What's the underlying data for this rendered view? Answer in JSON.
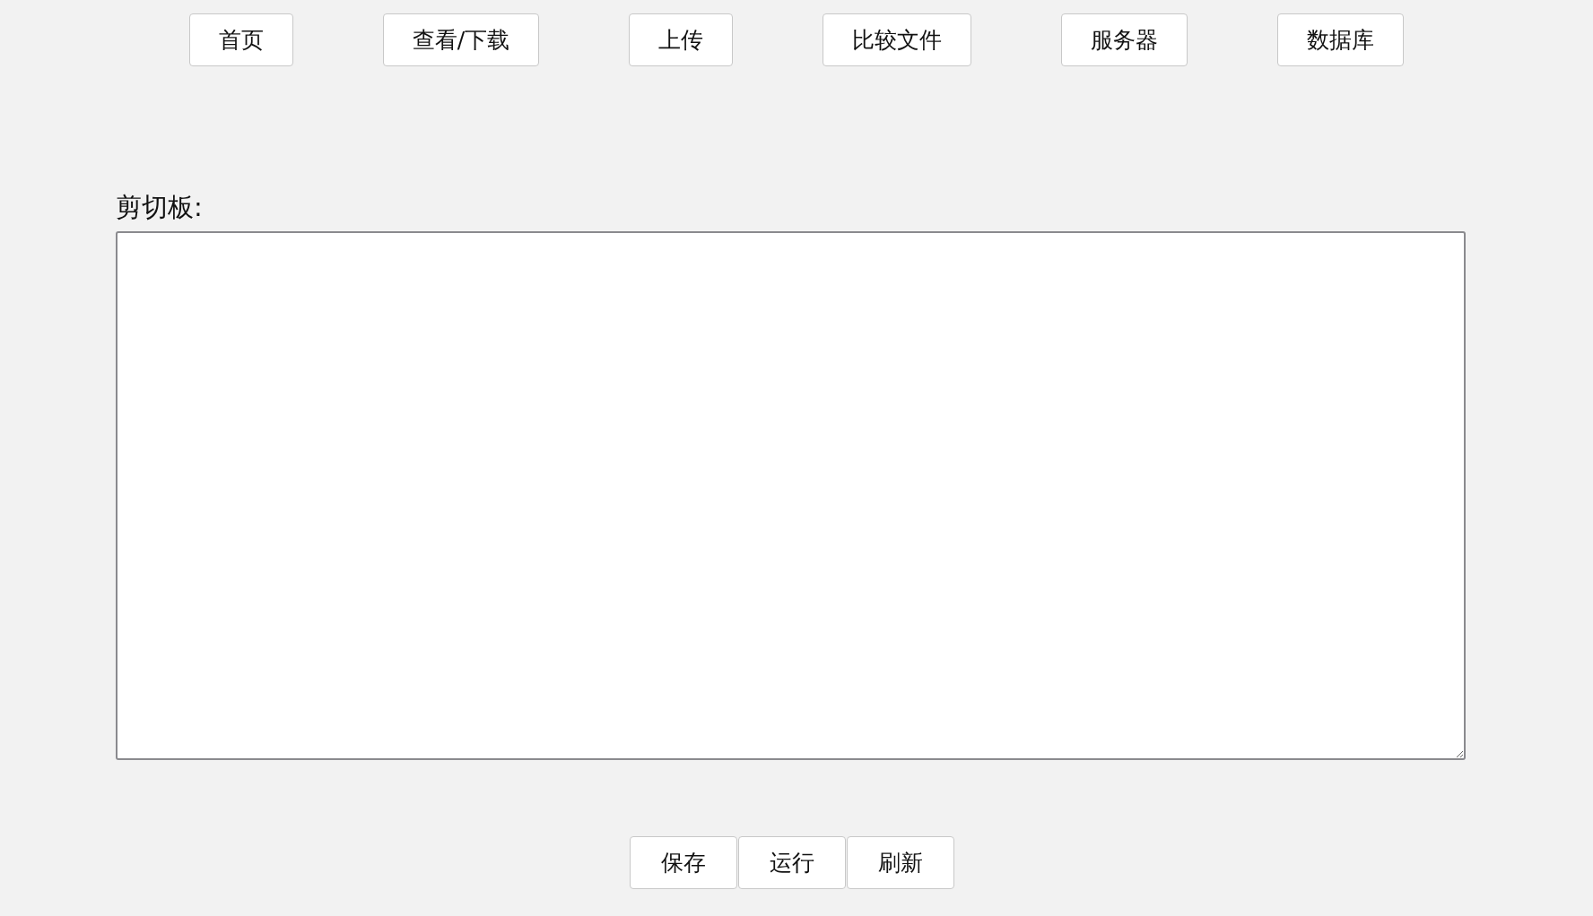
{
  "nav": [
    {
      "label": "首页"
    },
    {
      "label": "查看/下载"
    },
    {
      "label": "上传"
    },
    {
      "label": "比较文件"
    },
    {
      "label": "服务器"
    },
    {
      "label": "数据库"
    }
  ],
  "clipboard": {
    "label": "剪切板:"
  },
  "actions": [
    {
      "label": "保存"
    },
    {
      "label": "运行"
    },
    {
      "label": "刷新"
    }
  ]
}
